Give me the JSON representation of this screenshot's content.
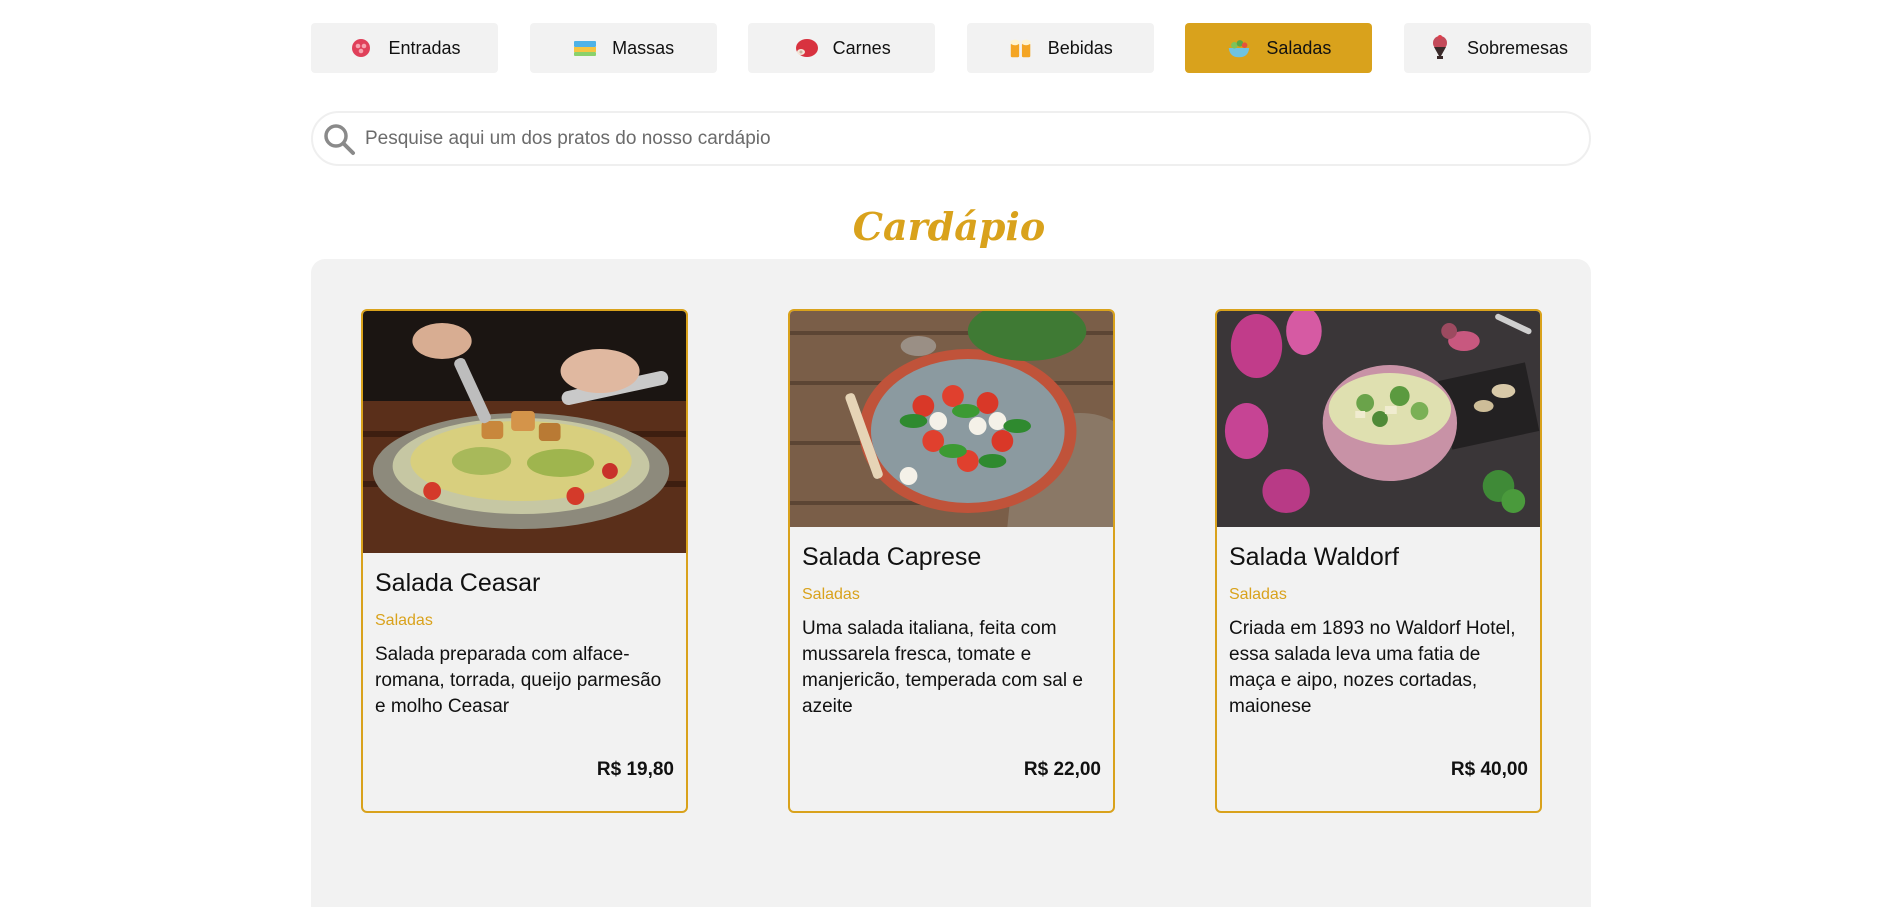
{
  "tabs": [
    {
      "label": "Entradas",
      "icon": "appetizer-icon",
      "active": false
    },
    {
      "label": "Massas",
      "icon": "pasta-icon",
      "active": false
    },
    {
      "label": "Carnes",
      "icon": "meat-icon",
      "active": false
    },
    {
      "label": "Bebidas",
      "icon": "beer-icon",
      "active": false
    },
    {
      "label": "Saladas",
      "icon": "salad-icon",
      "active": true
    },
    {
      "label": "Sobremesas",
      "icon": "dessert-icon",
      "active": false
    }
  ],
  "search": {
    "placeholder": "Pesquise aqui um dos pratos do nosso cardápio",
    "value": "",
    "icon": "search-icon"
  },
  "menu_title": "Cardápio",
  "cards": [
    {
      "name": "Salada Ceasar",
      "category": "Saladas",
      "description": "Salada preparada com alface-romana, torrada, queijo parmesão e molho Ceasar",
      "price": "R$ 19,80",
      "image": "caesar-salad-photo"
    },
    {
      "name": "Salada Caprese",
      "category": "Saladas",
      "description": "Uma salada italiana, feita com mussarela fresca, tomate e manjericão, temperada com sal e azeite",
      "price": "R$ 22,00",
      "image": "caprese-salad-photo"
    },
    {
      "name": "Salada Waldorf",
      "category": "Saladas",
      "description": "Criada em 1893 no Waldorf Hotel, essa salada leva uma fatia de maça e aipo, nozes cortadas, maionese",
      "price": "R$ 40,00",
      "image": "waldorf-salad-photo"
    }
  ],
  "colors": {
    "accent": "#d9a21c",
    "tab_bg": "#f2f2f2",
    "panel_bg": "#f2f2f2"
  }
}
